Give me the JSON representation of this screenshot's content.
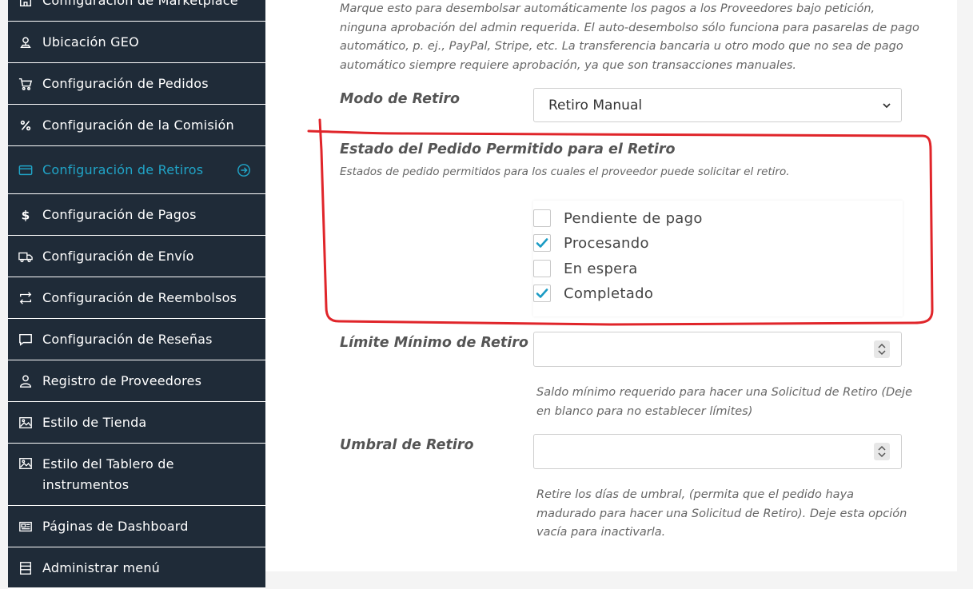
{
  "sidebar": {
    "items": [
      {
        "label": "Configuración de Marketplace",
        "icon": "store-icon"
      },
      {
        "label": "Ubicación GEO",
        "icon": "location-pin-icon"
      },
      {
        "label": "Configuración de Pedidos",
        "icon": "cart-icon"
      },
      {
        "label": "Configuración de la Comisión",
        "icon": "percent-icon"
      },
      {
        "label": "Configuración de Retiros",
        "icon": "credit-card-icon",
        "active": true
      },
      {
        "label": "Configuración de Pagos",
        "icon": "dollar-icon"
      },
      {
        "label": "Configuración de Envío",
        "icon": "truck-icon"
      },
      {
        "label": "Configuración de Reembolsos",
        "icon": "refund-arrows-icon"
      },
      {
        "label": "Configuración de Reseñas",
        "icon": "speech-bubble-icon"
      },
      {
        "label": "Registro de Proveedores",
        "icon": "user-icon"
      },
      {
        "label": "Estilo de Tienda",
        "icon": "image-icon"
      },
      {
        "label": "Estilo del Tablero de instrumentos",
        "icon": "image-icon"
      },
      {
        "label": "Páginas de Dashboard",
        "icon": "newspaper-icon"
      },
      {
        "label": "Administrar menú",
        "icon": "menu-list-icon"
      }
    ]
  },
  "content": {
    "auto_disburse_help": "Marque esto para desembolsar automáticamente los pagos a los Proveedores bajo petición, ninguna aprobación del admin requerida. El auto-desembolso sólo funciona para pasarelas de pago automático, p. ej., PayPal, Stripe, etc. La transferencia bancaria u otro modo que no sea de pago automático siempre requiere aprobación, ya que son transacciones manuales.",
    "withdrawal_mode": {
      "label": "Modo de Retiro",
      "selected": "Retiro Manual"
    },
    "order_status": {
      "label": "Estado del Pedido Permitido para el Retiro",
      "help": "Estados de pedido permitidos para los cuales el proveedor puede solicitar el retiro.",
      "options": [
        {
          "label": "Pendiente de pago",
          "checked": false
        },
        {
          "label": "Procesando",
          "checked": true
        },
        {
          "label": "En espera",
          "checked": false
        },
        {
          "label": "Completado",
          "checked": true
        }
      ]
    },
    "min_limit": {
      "label": "Límite Mínimo de Retiro",
      "value": "",
      "help": "Saldo mínimo requerido para hacer una Solicitud de Retiro (Deje en blanco para no establecer límites)"
    },
    "threshold": {
      "label": "Umbral de Retiro",
      "value": "",
      "help": "Retire los días de umbral, (permita que el pedido haya madurado para hacer una Solicitud de Retiro). Deje esta opción vacía para inactivarla."
    }
  },
  "colors": {
    "sidebar_bg": "#1f2b38",
    "active_accent": "#20a5c8",
    "checkmark": "#1a9bc4",
    "annotation_red": "#e0252a"
  }
}
